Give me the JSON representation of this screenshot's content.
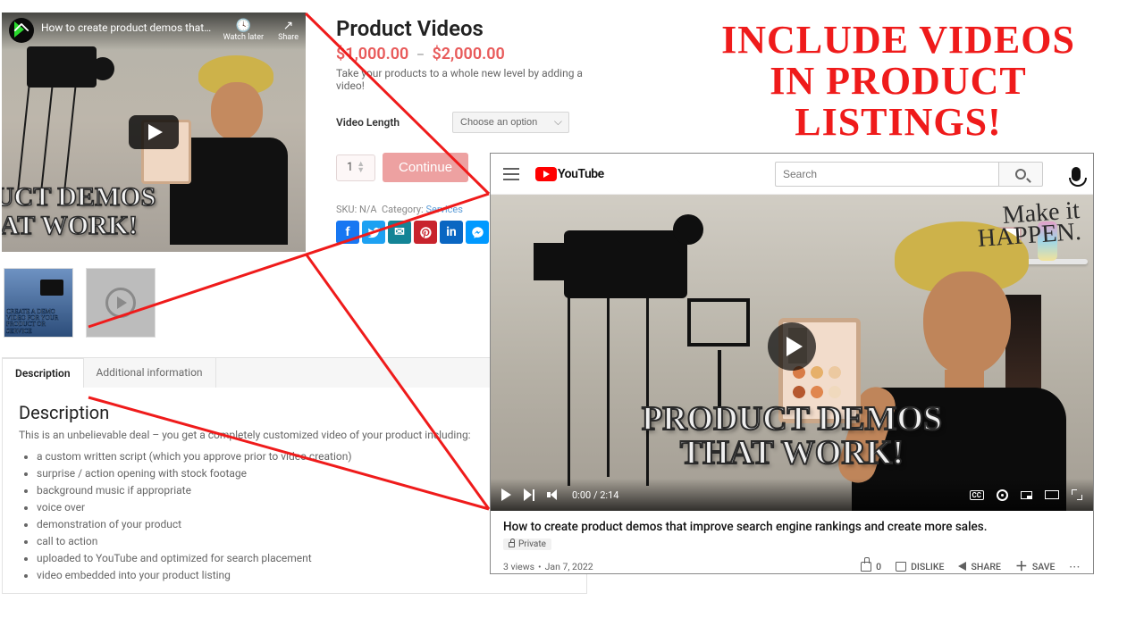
{
  "headline": "INCLUDE VIDEOS\nIN PRODUCT\nLISTINGS!",
  "product": {
    "embed": {
      "title": "How to create product demos that…",
      "watch_later": "Watch later",
      "share": "Share",
      "overlay_text": "UCT DEMOS\n AT WORK!"
    },
    "title": "Product Videos",
    "price_low": "$1,000.00",
    "price_high": "$2,000.00",
    "tagline": "Take your products to a whole new level by adding a video!",
    "variation_label": "Video Length",
    "variation_placeholder": "Choose an option",
    "qty": "1",
    "continue": "Continue",
    "sku_label": "SKU:",
    "sku_value": "N/A",
    "category_label": "Category:",
    "category_link": "Services",
    "thumbs": {
      "thumb1_text": "CREATE A DEMO\nVIDEO FOR YOUR\nPRODUCT OR SERVICE"
    },
    "tabs": {
      "description": "Description",
      "additional": "Additional information"
    },
    "description": {
      "heading": "Description",
      "intro": "This is an unbelievable deal – you get a completely customized video of your product including:",
      "bullets": [
        "a custom written script (which you approve prior to video creation)",
        "surprise / action opening with stock footage",
        "background music if appropriate",
        "voice over",
        "demonstration of your product",
        "call to action",
        "uploaded to YouTube and optimized for search placement",
        "video embedded into your product listing"
      ]
    }
  },
  "youtube": {
    "brand": "YouTube",
    "search_placeholder": "Search",
    "annotation": "Make it\nHAPPEN.",
    "overlay_text": "PRODUCT DEMOS\nTHAT WORK!",
    "time_elapsed": "0:00",
    "time_total": "2:14",
    "cc_label": "CC",
    "title": "How to create product demos that improve search engine rankings and create more sales.",
    "privacy": "Private",
    "views": "3 views",
    "date": "Jan 7, 2022",
    "like_count": "0",
    "dislike_label": "DISLIKE",
    "share_label": "SHARE",
    "save_label": "SAVE"
  }
}
